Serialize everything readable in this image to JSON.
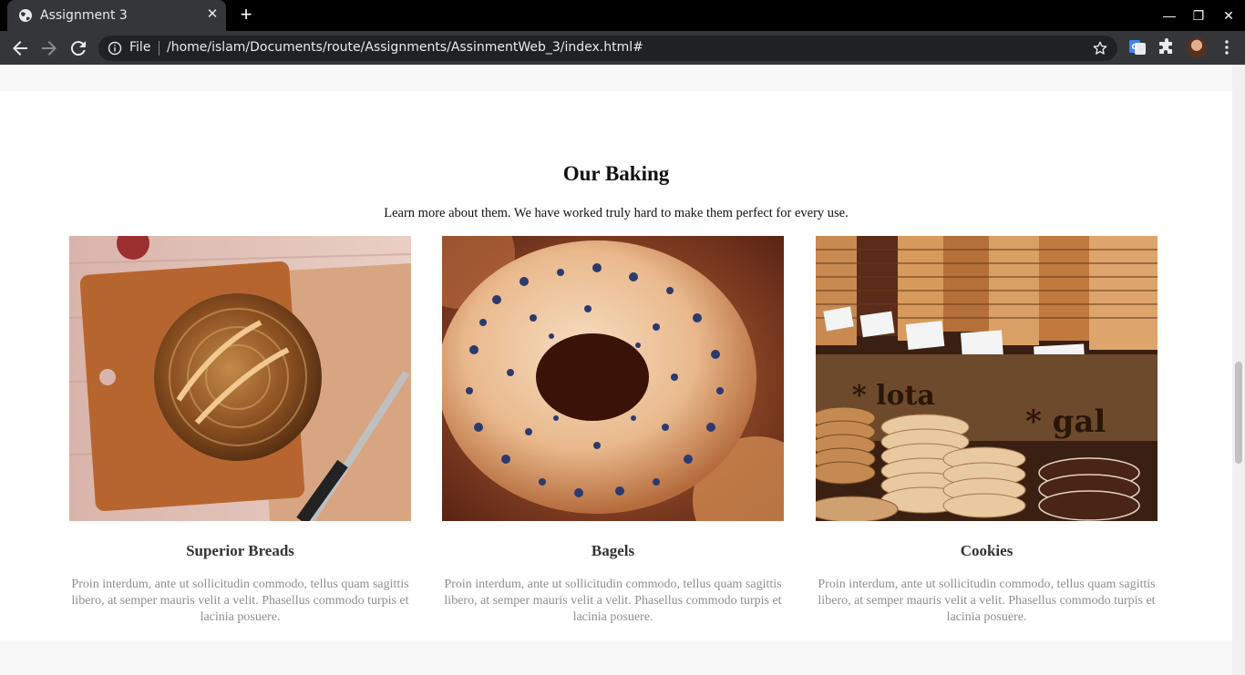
{
  "browser": {
    "tab_title": "Assignment 3",
    "url_scheme_label": "File",
    "url": "/home/islam/Documents/route/Assignments/AssinmentWeb_3/index.html#"
  },
  "section": {
    "title": "Our Baking",
    "subtitle": "Learn more about them. We have worked truly hard to make them perfect for every use."
  },
  "cards": [
    {
      "title": "Superior Breads",
      "text": "Proin interdum, ante ut sollicitudin commodo, tellus quam sagittis libero, at semper mauris velit a velit. Phasellus commodo turpis et lacinia posuere.",
      "image": "sourdough-bread-photo"
    },
    {
      "title": "Bagels",
      "text": "Proin interdum, ante ut sollicitudin commodo, tellus quam sagittis libero, at semper mauris velit a velit. Phasellus commodo turpis et lacinia posuere.",
      "image": "bagel-photo"
    },
    {
      "title": "Cookies",
      "text": "Proin interdum, ante ut sollicitudin commodo, tellus quam sagittis libero, at semper mauris velit a velit. Phasellus commodo turpis et lacinia posuere.",
      "image": "cookies-photo"
    }
  ],
  "colors": {
    "chrome_bg": "#35363a",
    "tabbar_bg": "#000000",
    "omnibox_bg": "#202124",
    "title_text": "#111111",
    "body_muted": "#8e8e8e",
    "section_band": "#f8f8f8"
  }
}
